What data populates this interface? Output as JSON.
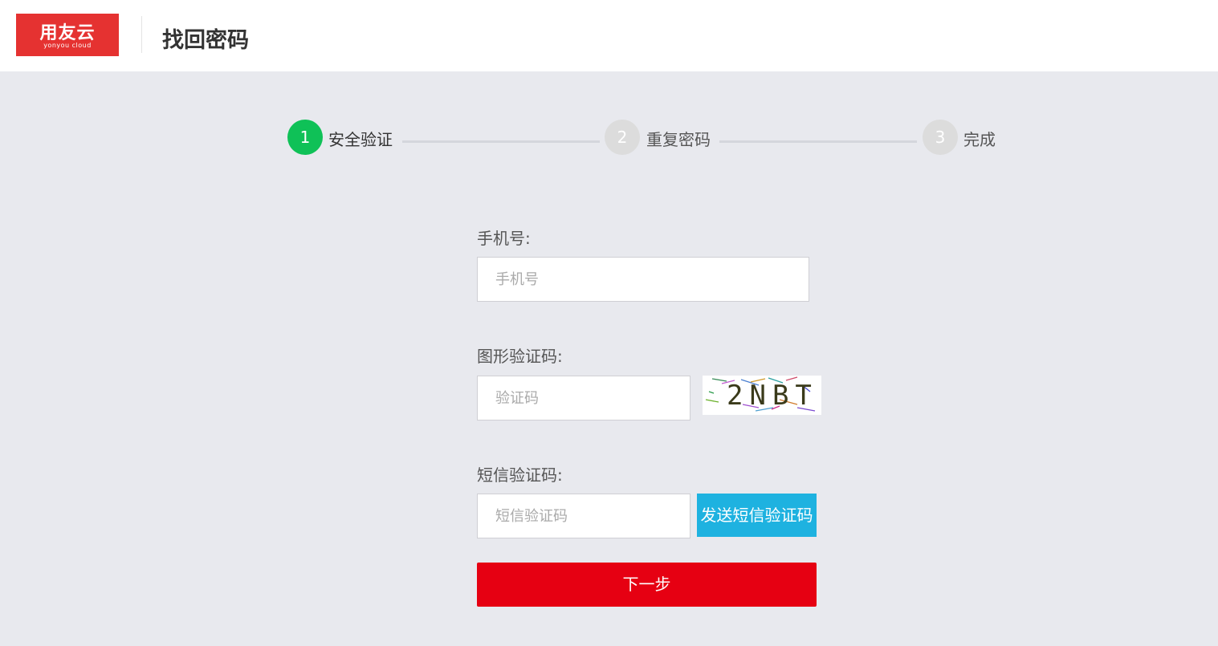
{
  "header": {
    "logo_text": "用友云",
    "logo_subtext": "yonyou cloud",
    "logo_color": "#e53231",
    "title": "找回密码"
  },
  "steps": [
    {
      "number": "1",
      "label": "安全验证",
      "state": "active",
      "color": "#0fc157"
    },
    {
      "number": "2",
      "label": "重复密码",
      "state": "pending",
      "color": "#dcdcdc"
    },
    {
      "number": "3",
      "label": "完成",
      "state": "pending",
      "color": "#dcdcdc"
    }
  ],
  "form": {
    "phone": {
      "label": "手机号:",
      "placeholder": "手机号",
      "value": ""
    },
    "captcha": {
      "label": "图形验证码:",
      "placeholder": "验证码",
      "value": "",
      "image_text": "2NBT"
    },
    "sms": {
      "label": "短信验证码:",
      "placeholder": "短信验证码",
      "value": "",
      "send_button": "发送短信验证码",
      "button_color": "#1eb2e0"
    },
    "next_button": "下一步",
    "next_button_color": "#e60012"
  }
}
